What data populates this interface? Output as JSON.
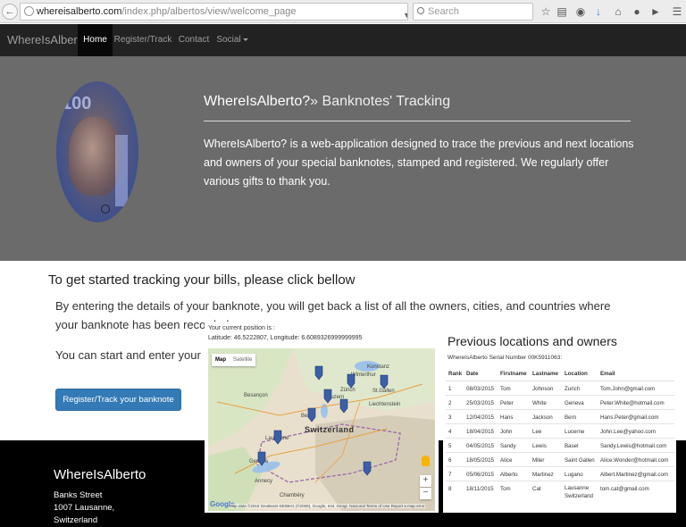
{
  "browser": {
    "url_host": "whereisalberto.com",
    "url_path": "/index.php/albertos/view/welcome_page",
    "search_placeholder": "Search"
  },
  "navbar": {
    "brand": "WhereIsAlberto",
    "items": [
      {
        "label": "Home"
      },
      {
        "label": "Register/Track"
      },
      {
        "label": "Contact"
      },
      {
        "label": "Social"
      }
    ]
  },
  "jumbotron": {
    "title": "WhereIsAlberto?",
    "subtitle": "» Banknotes' Tracking",
    "description": "WhereIsAlberto? is a web-application designed to trace the previous and next locations and owners of your special banknotes, stamped and registered. We regularly offer various gifts to thank you.",
    "note_denomination": "100"
  },
  "main": {
    "heading": "To get started tracking your bills, please click bellow",
    "paragraph1": "By entering the details of your banknote, you will get back a list of all the owners, cities, and countries where your banknote has been recorded.",
    "paragraph2": "You can start and enter your ow",
    "button_label": "Register/Track your banknote now!"
  },
  "footer": {
    "brand": "WhereIsAlberto",
    "address": [
      "Banks Street",
      "1007 Lausanne,",
      "Switzerland"
    ]
  },
  "map_panel": {
    "position_label": "Your current position is :",
    "coordinates": "Latitude: 46.5222807, Longitude: 6.6089326999999995",
    "map_type": [
      "Map",
      "Satellite"
    ],
    "country_label": "Switzerland",
    "places": [
      "Konstanz",
      "Winterthur",
      "Zürich",
      "St.Gallen",
      "Liechtenstein",
      "Besançon",
      "Lausanne",
      "Geneva",
      "Annecy",
      "Chambéry",
      "Bern",
      "Luzern"
    ],
    "attribution": "Map data ©2015 GeoBasis-DE/BKG (©2009), Google, Inst. Geogr. Nacional   Terms of Use   Report a map error",
    "logo": "Google"
  },
  "table_panel": {
    "title": "Previous locations and owners",
    "serial": "WhereIsAlberto Serial Number 00K5911063:",
    "headers": [
      "Rank",
      "Date",
      "Firstname",
      "Lastname",
      "Location",
      "Email"
    ],
    "rows": [
      [
        "1",
        "08/03/2015",
        "Tom",
        "Johnson",
        "Zurich",
        "Tom.John@gmail.com"
      ],
      [
        "2",
        "25/03/2015",
        "Peter",
        "White",
        "Geneva",
        "Peter.White@hotmail.com"
      ],
      [
        "3",
        "12/04/2015",
        "Hans",
        "Jackson",
        "Bern",
        "Hans.Peter@gmail.com"
      ],
      [
        "4",
        "18/04/2015",
        "John",
        "Lee",
        "Lucerne",
        "John.Lee@yahoo.com"
      ],
      [
        "5",
        "04/05/2015",
        "Sandy",
        "Lewis",
        "Basel",
        "Sandy.Lewis@hotmail.com"
      ],
      [
        "6",
        "18/05/2015",
        "Alice",
        "Miler",
        "Saint Gallen",
        "Alice.Wonder@hotmail.com"
      ],
      [
        "7",
        "05/06/2015",
        "Alberto",
        "Martinez",
        "Lugano",
        "Albert.Martinez@gmail.com"
      ],
      [
        "8",
        "18/11/2015",
        "Tom",
        "Cat",
        "Lausanne Switzerland",
        "tom.cat@gmail.com"
      ]
    ]
  }
}
